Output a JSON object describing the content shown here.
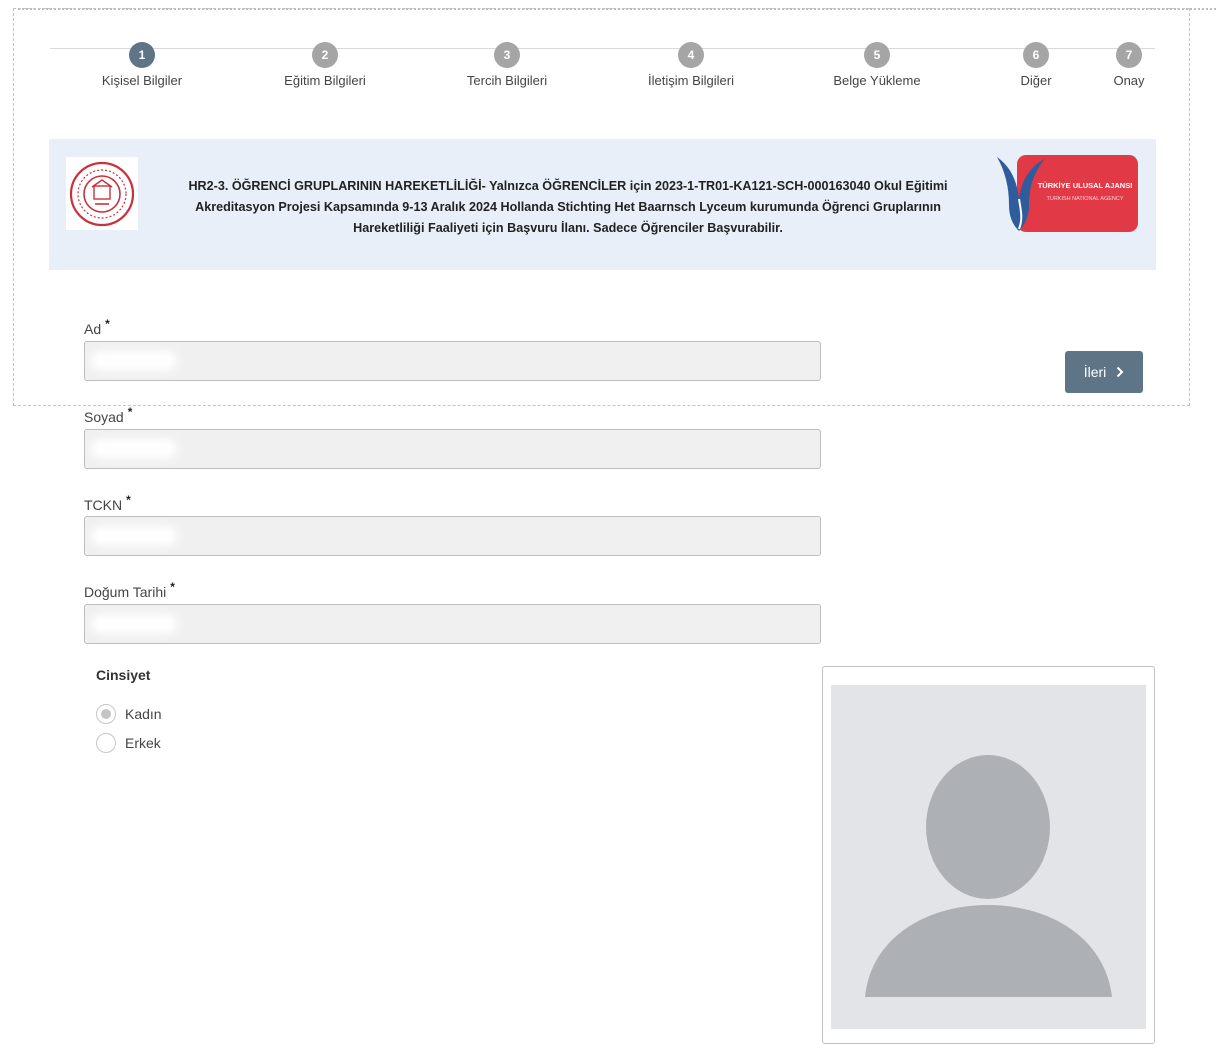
{
  "stepper": {
    "steps": [
      {
        "number": "1",
        "label": "Kişisel Bilgiler",
        "active": true
      },
      {
        "number": "2",
        "label": "Eğitim Bilgileri",
        "active": false
      },
      {
        "number": "3",
        "label": "Tercih Bilgileri",
        "active": false
      },
      {
        "number": "4",
        "label": "İletişim Bilgileri",
        "active": false
      },
      {
        "number": "5",
        "label": "Belge Yükleme",
        "active": false
      },
      {
        "number": "6",
        "label": "Diğer",
        "active": false
      },
      {
        "number": "7",
        "label": "Onay",
        "active": false
      }
    ]
  },
  "banner": {
    "text_line1": "HR2-3. ÖĞRENCİ GRUPLARININ HAREKETLİLİĞİ- Yalnızca ÖĞRENCİLER için 2023-1-TR01-KA121-SCH-000163040 Okul Eğitimi",
    "text_line2": "Akreditasyon Projesi Kapsamında 9-13 Aralık 2024 Hollanda Stichting Het Baarnsch Lyceum kurumunda Öğrenci Gruplarının",
    "text_line3": "Hareketliliği Faaliyeti için Başvuru İlanı. Sadece Öğrenciler Başvurabilir.",
    "right_logo_text1": "TÜRKİYE ULUSAL AJANSI",
    "right_logo_text2": "TURKISH NATIONAL AGENCY"
  },
  "form": {
    "ad_label": "Ad",
    "soyad_label": "Soyad",
    "tckn_label": "TCKN",
    "dogum_label": "Doğum Tarihi",
    "required_mark": "*",
    "gender_title": "Cinsiyet",
    "gender_options": [
      "Kadın",
      "Erkek"
    ],
    "gender_selected": "Kadın"
  },
  "buttons": {
    "next_label": "İleri",
    "next_icon": "chevron-right-icon"
  },
  "colors": {
    "accent": "#5d7586",
    "inactive_step": "#a5a5a5",
    "banner_bg": "#e9eff8",
    "agency_red": "#e23947"
  }
}
